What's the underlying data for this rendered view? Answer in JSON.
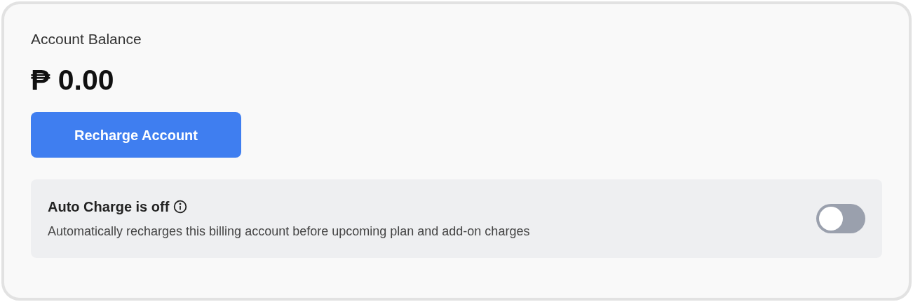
{
  "balance": {
    "label": "Account Balance",
    "amount": "₱ 0.00"
  },
  "recharge_button": {
    "label": "Recharge Account"
  },
  "auto_charge": {
    "title": "Auto Charge is off",
    "description": "Automatically recharges this billing account before upcoming plan and add-on charges",
    "on": false
  }
}
